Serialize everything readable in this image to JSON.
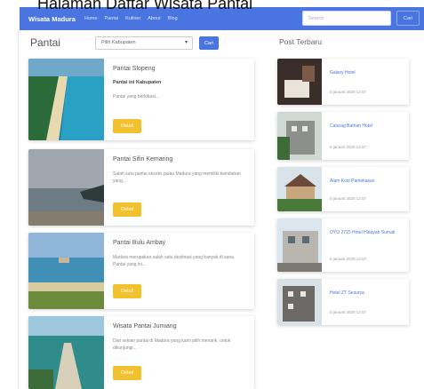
{
  "caption": "Halaman Daftar Wisata Pantai",
  "navbar": {
    "brand": "Wisata Madura",
    "links": [
      "Home",
      "Pantai",
      "Kuliner",
      "About",
      "Blog"
    ],
    "search_placeholder": "Search",
    "search_button": "Cari"
  },
  "main": {
    "title": "Pantai",
    "filter_select": "Pilih Kabupaten",
    "filter_button": "Cari"
  },
  "cards": [
    {
      "title": "Pantai Slopeng",
      "sub": "Pantai ini Kabupaten",
      "text": "Pantai yang berlokasi...",
      "button": "Detail"
    },
    {
      "title": "Pantai Sifiri Kemaring",
      "sub": "",
      "text": "Salah satu pantai eksotis pulau Madura yang memiliki keindahan yang...",
      "button": "Detail"
    },
    {
      "title": "Pantai Bulu Ambay",
      "sub": "",
      "text": "Madura merupakan salah satu destinasi yang banyak di sana. Pantai yang ini...",
      "button": "Detail"
    },
    {
      "title": "Wisata Pantai Jumiang",
      "sub": "",
      "text": "Dari sekian pantai di Madura yang kami pilih menarik, untuk dikunjungi...",
      "button": "Detail"
    }
  ],
  "sidebar": {
    "title": "Post Terbaru",
    "posts": [
      {
        "title": "Galaxy Hotel",
        "date": "6 januari 2020 12:57"
      },
      {
        "title": "Caturag Bathan Hotel",
        "date": "6 januari 2020 12:57"
      },
      {
        "title": "Alam Kost Pamekasan",
        "date": "6 januari 2020 12:57"
      },
      {
        "title": "OYO 2715 Hotel Hidayah Sumati",
        "date": "6 januari 2020 12:57"
      },
      {
        "title": "Hotel ZT Sesurya",
        "date": "6 januari 2020 12:57"
      }
    ]
  },
  "colors": {
    "primary": "#4a74e0",
    "button_yellow": "#f2c12e"
  }
}
